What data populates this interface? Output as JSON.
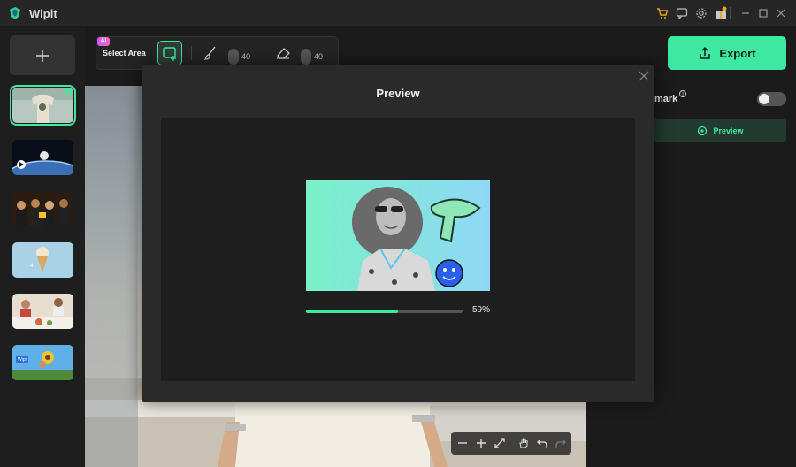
{
  "app": {
    "title": "Wipit"
  },
  "colors": {
    "accent": "#3ee8a0",
    "background": "#1b1b1b",
    "panel": "#242424",
    "modal": "#2a2a2a"
  },
  "titlebar": {
    "icons": [
      "cart-icon",
      "feedback-icon",
      "settings-icon",
      "gift-icon",
      "minimize-icon",
      "maximize-icon",
      "close-icon"
    ]
  },
  "sidebar": {
    "add_label": "+",
    "thumbnails": [
      {
        "name": "thumb-person-tshirt",
        "active": true
      },
      {
        "name": "thumb-astronaut-earth",
        "active": false
      },
      {
        "name": "thumb-graduation-crowd",
        "active": false
      },
      {
        "name": "thumb-ice-cream",
        "active": false
      },
      {
        "name": "thumb-dinner-table",
        "active": false
      },
      {
        "name": "thumb-sunflower-girl",
        "active": false
      }
    ]
  },
  "toolbar": {
    "ai_badge": "AI",
    "select_area_label": "Select Area",
    "brush_size": "40",
    "eraser_size": "40"
  },
  "export": {
    "label": "Export"
  },
  "right_panel": {
    "watermark_label": "mark",
    "watermark_info": "i",
    "watermark_enabled": false,
    "preview_label": "Preview"
  },
  "modal": {
    "title": "Preview",
    "progress_percent": 59,
    "progress_text": "59%"
  }
}
